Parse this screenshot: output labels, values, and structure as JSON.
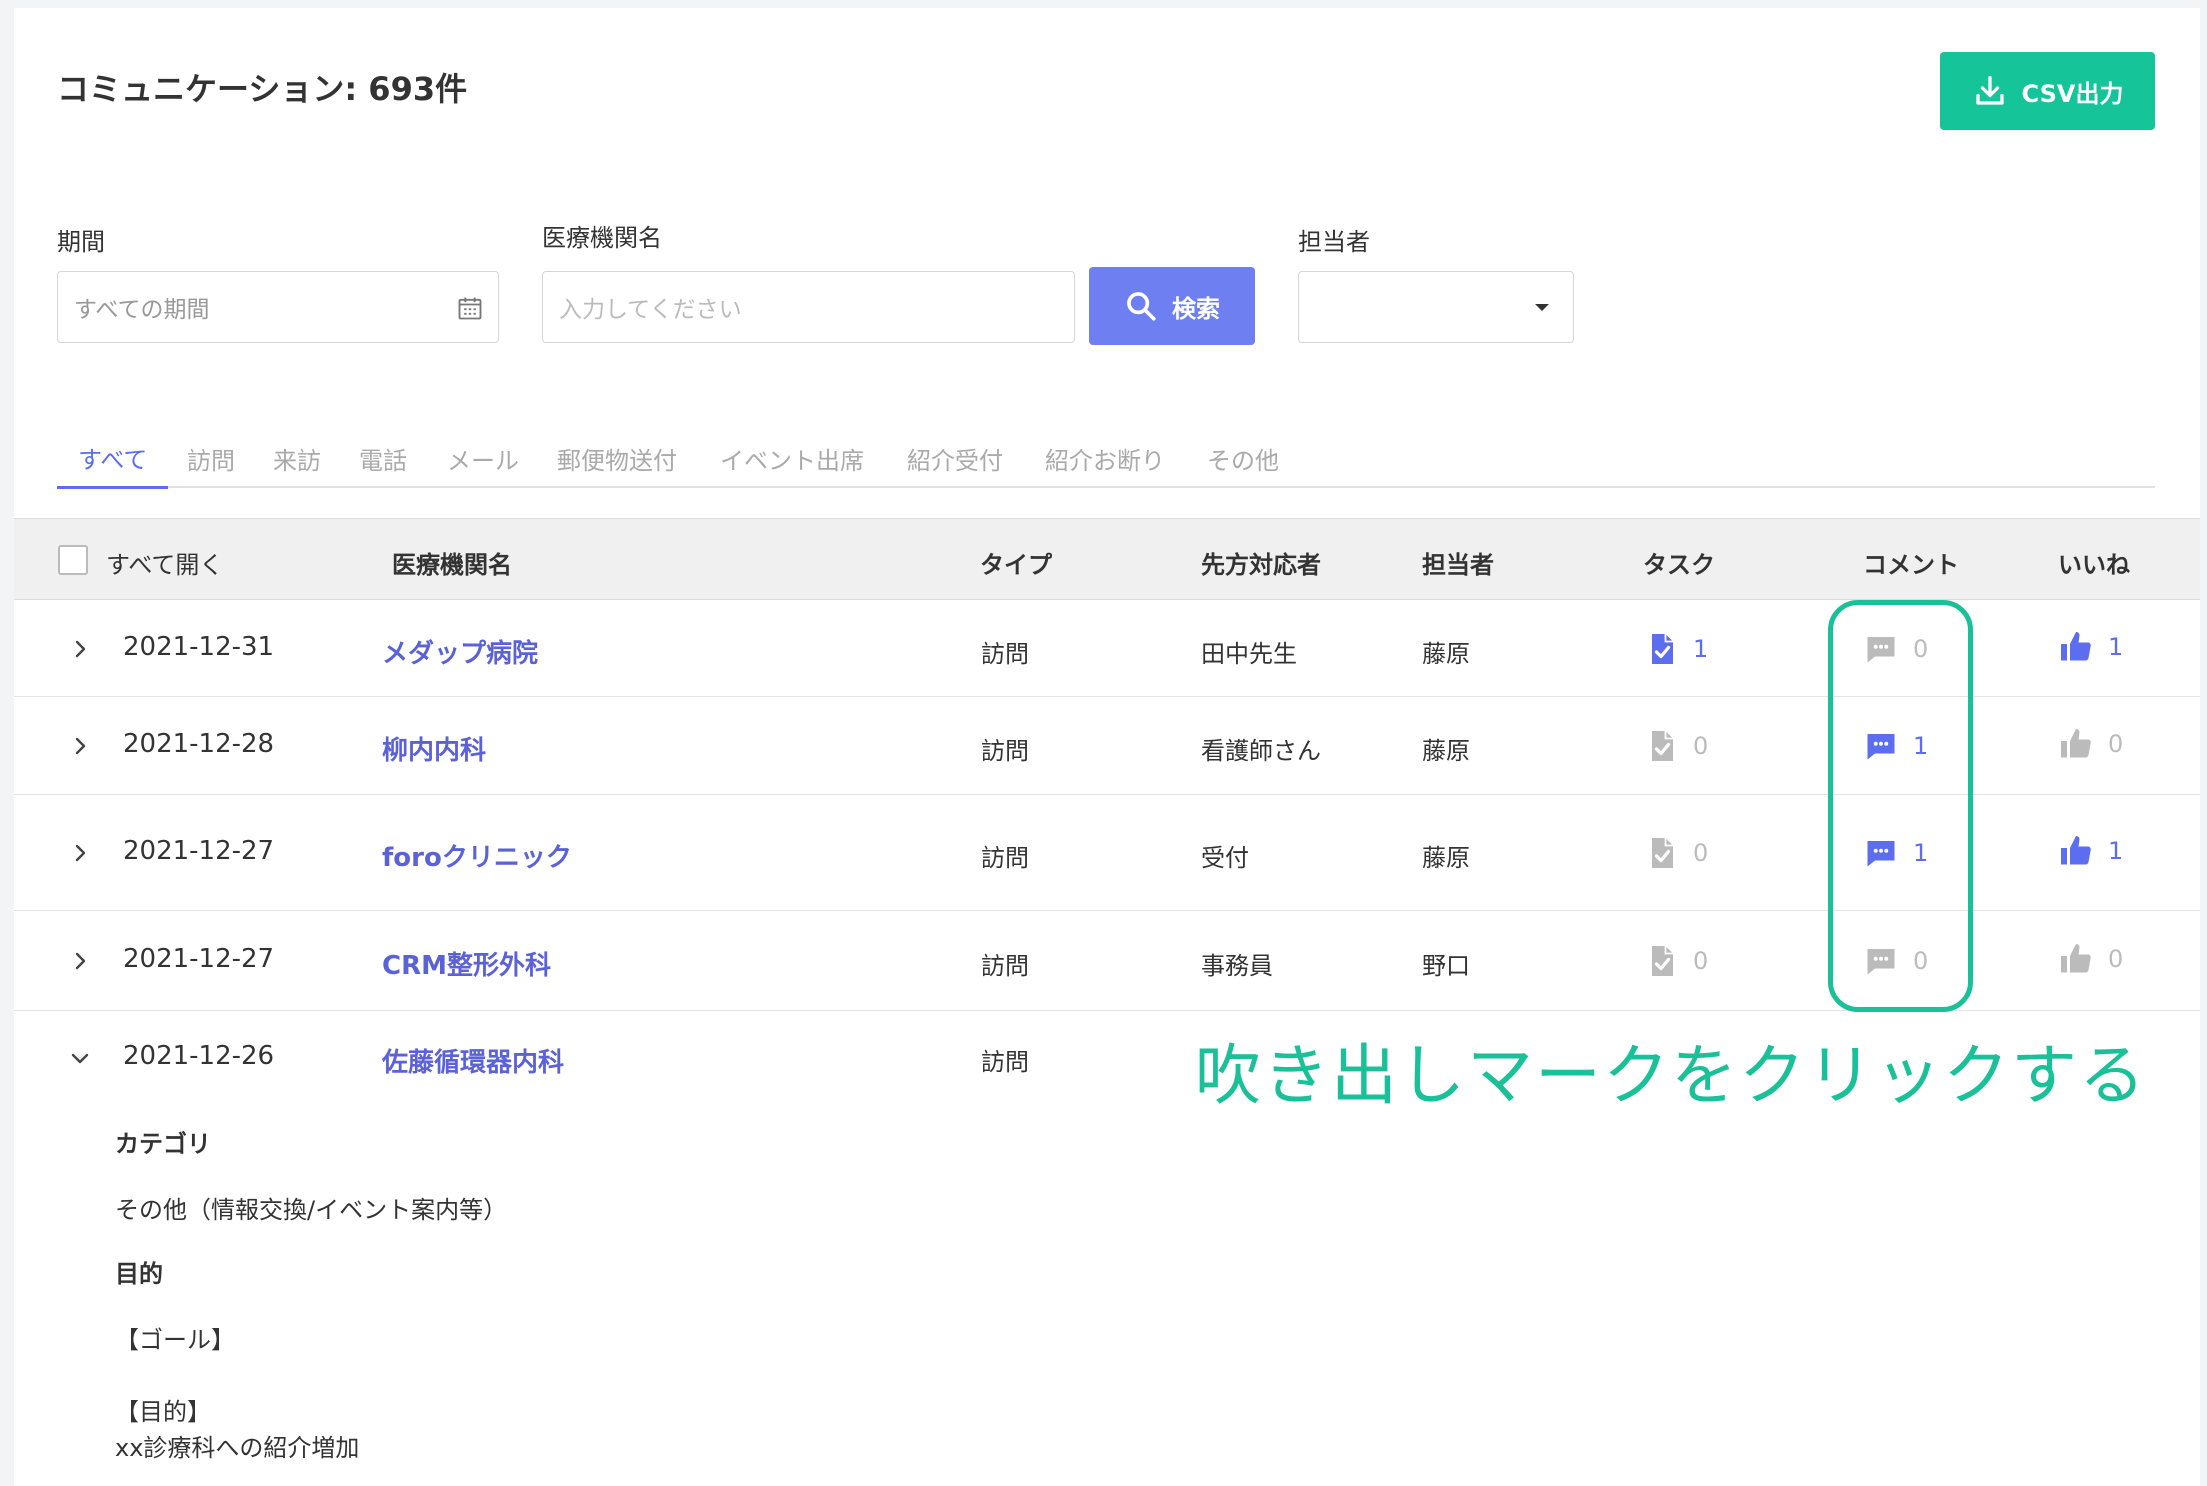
{
  "header": {
    "title": "コミュニケーション: 693件",
    "csv_label": "CSV出力"
  },
  "filters": {
    "period_label": "期間",
    "period_placeholder": "すべての期間",
    "institution_label": "医療機関名",
    "institution_placeholder": "入力してください",
    "search_label": "検索",
    "staff_label": "担当者",
    "staff_value": ""
  },
  "tabs": [
    "すべて",
    "訪問",
    "来訪",
    "電話",
    "メール",
    "郵便物送付",
    "イベント出席",
    "紹介受付",
    "紹介お断り",
    "その他"
  ],
  "table": {
    "open_all": "すべて開く",
    "headers": {
      "institution": "医療機関名",
      "type": "タイプ",
      "contact": "先方対応者",
      "staff": "担当者",
      "task": "タスク",
      "comment": "コメント",
      "like": "いいね"
    },
    "rows": [
      {
        "date": "2021-12-31",
        "institution": "メダップ病院",
        "type": "訪問",
        "contact": "田中先生",
        "staff": "藤原",
        "task": "1",
        "comment": "0",
        "like": "1",
        "task_on": true,
        "comment_on": false,
        "like_on": true
      },
      {
        "date": "2021-12-28",
        "institution": "柳内内科",
        "type": "訪問",
        "contact": "看護師さん",
        "staff": "藤原",
        "task": "0",
        "comment": "1",
        "like": "0",
        "task_on": false,
        "comment_on": true,
        "like_on": false
      },
      {
        "date": "2021-12-27",
        "institution": "foroクリニック",
        "type": "訪問",
        "contact": "受付",
        "staff": "藤原",
        "task": "0",
        "comment": "1",
        "like": "1",
        "task_on": false,
        "comment_on": true,
        "like_on": true
      },
      {
        "date": "2021-12-27",
        "institution": "CRM整形外科",
        "type": "訪問",
        "contact": "事務員",
        "staff": "野口",
        "task": "0",
        "comment": "0",
        "like": "0",
        "task_on": false,
        "comment_on": false,
        "like_on": false
      }
    ],
    "expanded": {
      "date": "2021-12-26",
      "institution": "佐藤循環器内科",
      "type": "訪問",
      "category_label": "カテゴリ",
      "category_value": "その他（情報交換/イベント案内等）",
      "purpose_label": "目的",
      "goal_text": "【ゴール】",
      "purpose_text": "【目的】",
      "purpose_detail": "xx診療科への紹介増加"
    }
  },
  "annotation": "吹き出しマークをクリックする",
  "colors": {
    "accent": "#5c6df0",
    "green": "#16c49a",
    "link": "#5b62d8",
    "muted": "#bbbbbb"
  }
}
